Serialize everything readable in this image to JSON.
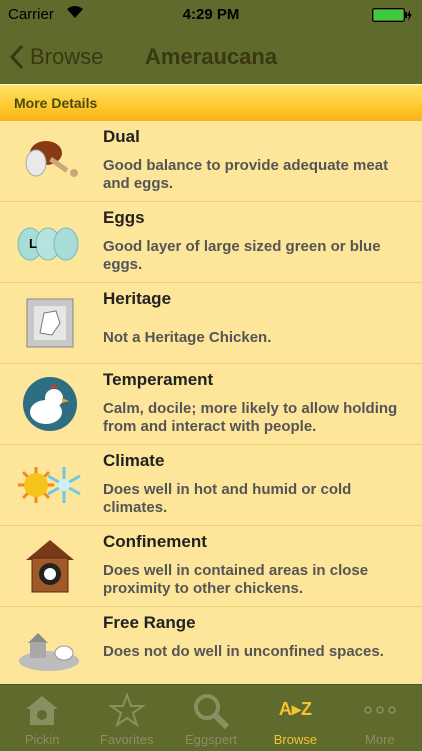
{
  "status": {
    "carrier": "Carrier",
    "time": "4:29 PM"
  },
  "nav": {
    "back_label": "Browse",
    "title": "Ameraucana"
  },
  "section": {
    "header": "More Details"
  },
  "rows": [
    {
      "icon": "drumstick-egg-icon",
      "title": "Dual",
      "desc": "Good balance to provide adequate meat and eggs."
    },
    {
      "icon": "eggs-icon",
      "title": "Eggs",
      "desc": "Good layer of large sized green or blue eggs.",
      "egg_letter": "L"
    },
    {
      "icon": "heritage-chicken-icon",
      "title": "Heritage",
      "desc": "Not a Heritage Chicken."
    },
    {
      "icon": "rooster-icon",
      "title": "Temperament",
      "desc": "Calm, docile; more likely to allow holding from and interact with people."
    },
    {
      "icon": "sun-snowflake-icon",
      "title": "Climate",
      "desc": "Does well in hot and humid or cold climates."
    },
    {
      "icon": "coop-icon",
      "title": "Confinement",
      "desc": "Does well in contained areas in close proximity to other chickens."
    },
    {
      "icon": "free-range-icon",
      "title": "Free Range",
      "desc": "Does not do well in unconfined spaces."
    }
  ],
  "tabs": [
    {
      "icon": "house-icon",
      "label": "Pickin"
    },
    {
      "icon": "star-icon",
      "label": "Favorites"
    },
    {
      "icon": "magnifier-icon",
      "label": "Eggspert"
    },
    {
      "icon": "az-icon",
      "label": "Browse",
      "active": true,
      "icon_text": "A▸Z"
    },
    {
      "icon": "more-icon",
      "label": "More"
    }
  ],
  "colors": {
    "bar": "#5f6a2d",
    "row_bg": "#fde59a",
    "active_tab": "#f4c430"
  }
}
